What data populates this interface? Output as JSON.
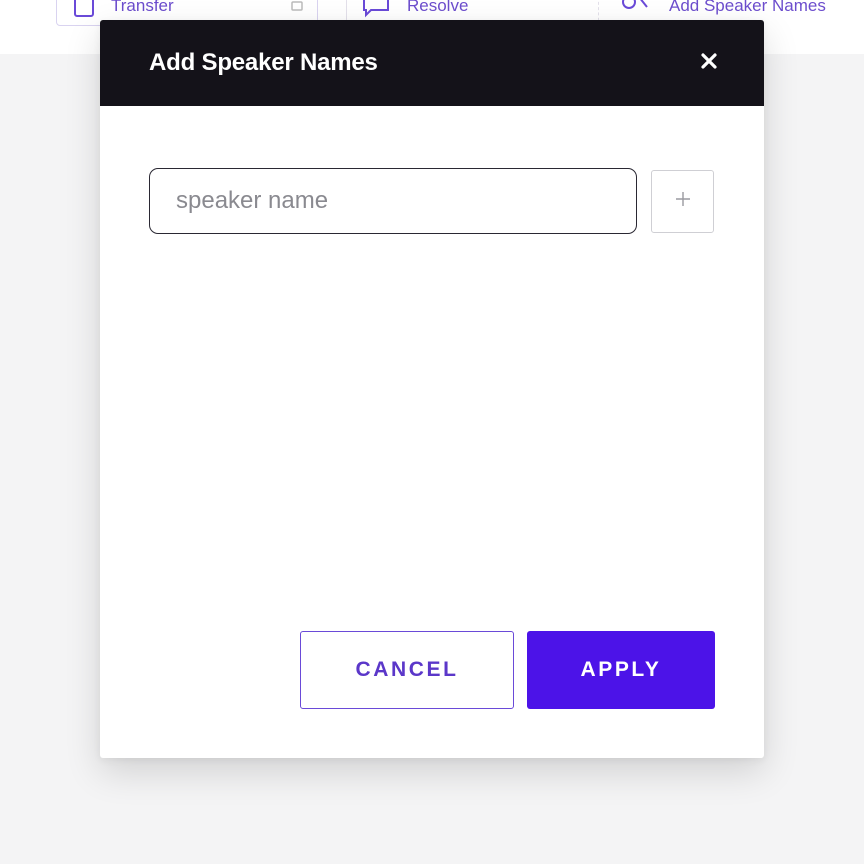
{
  "toolbar": {
    "items": [
      {
        "label": "Transfer",
        "icon": "document-icon"
      },
      {
        "label": "Resolve",
        "icon": "comment-icon"
      },
      {
        "label": "Add Speaker Names",
        "icon": "speaker-add-icon"
      }
    ]
  },
  "modal": {
    "title": "Add Speaker Names",
    "close_icon": "close-icon",
    "input": {
      "placeholder": "speaker name",
      "value": ""
    },
    "add_icon": "plus-icon",
    "cancel_label": "CANCEL",
    "apply_label": "APPLY"
  },
  "colors": {
    "header_bg": "#141219",
    "accent": "#4c13e8",
    "accent_text": "#5b37c9"
  }
}
